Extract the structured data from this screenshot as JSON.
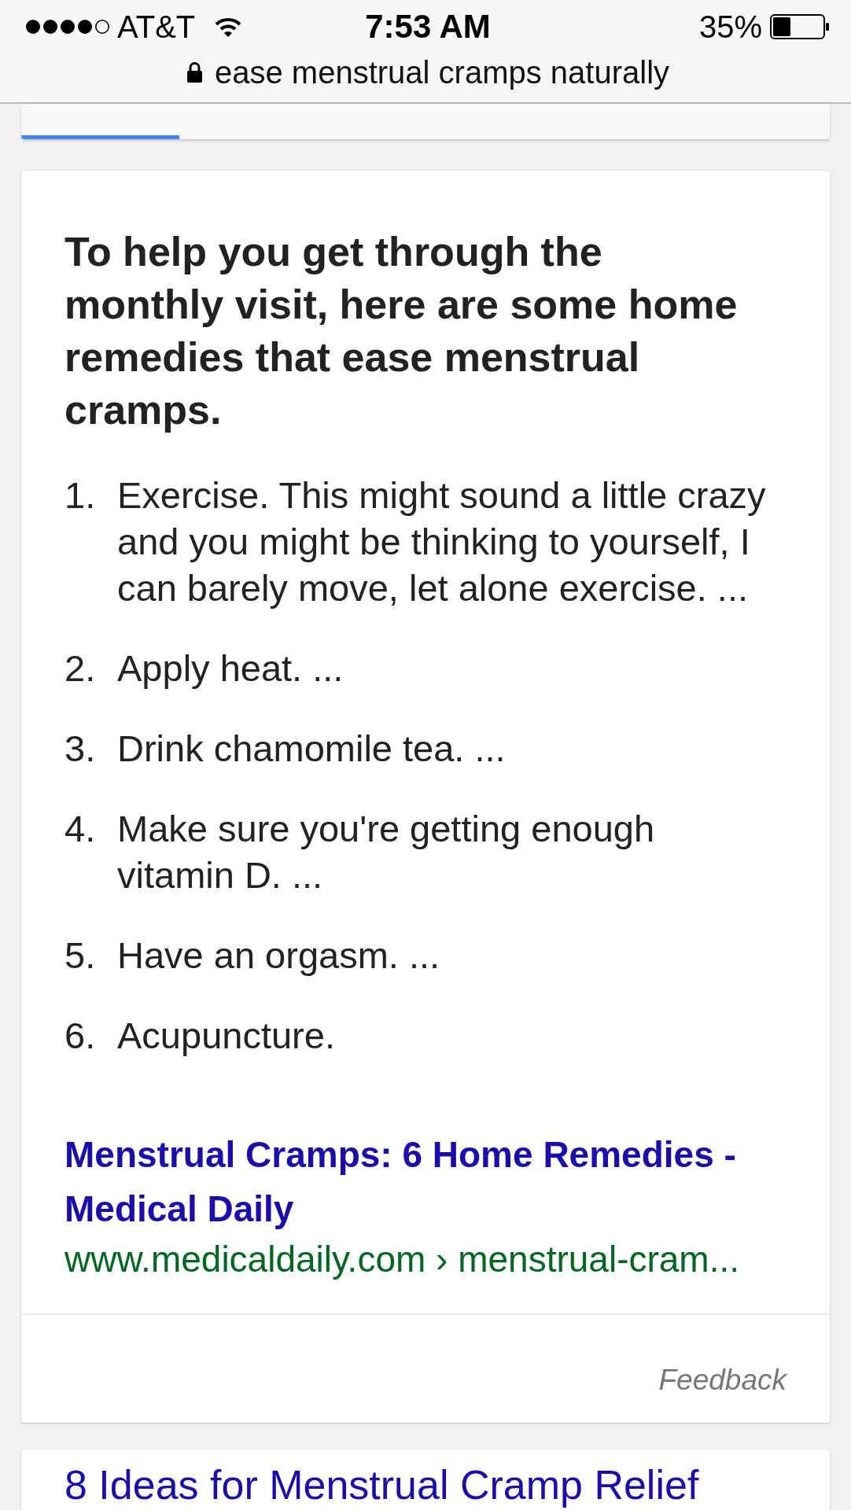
{
  "status_bar": {
    "carrier": "AT&T",
    "time": "7:53 AM",
    "battery": "35%"
  },
  "address_bar": {
    "query": "ease menstrual cramps naturally"
  },
  "featured_snippet": {
    "heading": "To help you get through the monthly visit, here are some home remedies that ease menstrual cramps.",
    "list": [
      {
        "number": "1.",
        "lines": [
          "Exercise. This might sound a little crazy",
          "and you might be thinking to yourself, I",
          "can barely move, let alone exercise. ..."
        ]
      },
      {
        "number": "2.",
        "lines": [
          "Apply heat. ..."
        ]
      },
      {
        "number": "3.",
        "lines": [
          "Drink chamomile tea. ..."
        ]
      },
      {
        "number": "4.",
        "lines": [
          "Make sure you're getting enough",
          "vitamin D. ..."
        ]
      },
      {
        "number": "5.",
        "lines": [
          "Have an orgasm. ..."
        ]
      },
      {
        "number": "6.",
        "lines": [
          "Acupuncture."
        ]
      }
    ],
    "source": {
      "title": "Menstrual Cramps: 6 Home Remedies - Medical Daily",
      "url": "www.medicaldaily.com › menstrual-cram..."
    },
    "feedback": "Feedback"
  },
  "next_result": {
    "title": "8 Ideas for Menstrual Cramp Relief"
  }
}
